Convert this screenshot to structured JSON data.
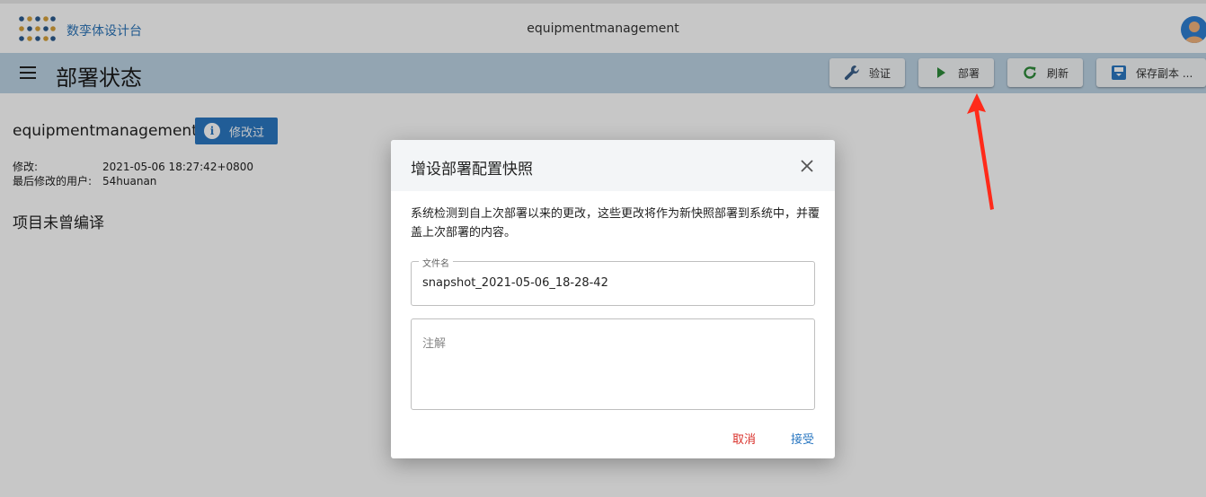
{
  "topbar": {
    "brand": "数孪体设计台",
    "app_title": "equipmentmanagement",
    "logo_icon": "dot-grid-logo",
    "avatar_icon": "user-avatar-icon"
  },
  "subbar": {
    "title": "部署状态",
    "buttons": [
      {
        "label": "验证",
        "icon": "wrench-icon"
      },
      {
        "label": "部署",
        "icon": "play-icon"
      },
      {
        "label": "刷新",
        "icon": "refresh-icon"
      },
      {
        "label": "保存副本 ...",
        "icon": "save-icon"
      }
    ]
  },
  "project": {
    "name": "equipmentmanagement",
    "badge": "修改过",
    "modified_key": "修改:",
    "modified_value": "2021-05-06 18:27:42+0800",
    "user_key": "最后修改的用户:",
    "user_value": "54huanan",
    "compile_status": "项目未曾编译"
  },
  "dialog": {
    "title": "增设部署配置快照",
    "description": "系统检测到自上次部署以来的更改，这些更改将作为新快照部署到系统中，并覆盖上次部署的内容。",
    "filename_label": "文件名",
    "filename_value": "snapshot_2021-05-06_18-28-42",
    "comment_placeholder": "注解",
    "cancel_label": "取消",
    "accept_label": "接受"
  },
  "colors": {
    "accent": "#2b78c2",
    "subbar": "#bdd4e5",
    "cancel": "#d9312b",
    "arrow": "#ff2a1a",
    "play": "#2e8b3a"
  }
}
